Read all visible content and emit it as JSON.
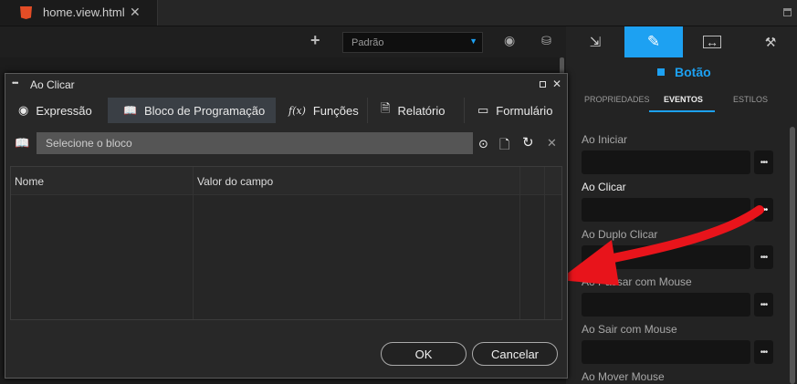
{
  "editor": {
    "file_tab": "home.view.html",
    "theme_select": "Padrão"
  },
  "right_panel": {
    "component_title": "Botão",
    "subtabs": [
      "PROPRIEDADES",
      "EVENTOS",
      "ESTILOS"
    ],
    "events": [
      "Ao Iniciar",
      "Ao Clicar",
      "Ao Duplo Clicar",
      "Ao Passar com Mouse",
      "Ao Sair com Mouse",
      "Ao Mover Mouse"
    ],
    "accent_color": "#1da1f2"
  },
  "dialog": {
    "title": "Ao Clicar",
    "tabs": [
      "Expressão",
      "Bloco de Programação",
      "Funções",
      "Relatório",
      "Formulário"
    ],
    "block_placeholder": "Selecione o bloco",
    "columns": [
      "Nome",
      "Valor do campo"
    ],
    "ok_label": "OK",
    "cancel_label": "Cancelar"
  }
}
